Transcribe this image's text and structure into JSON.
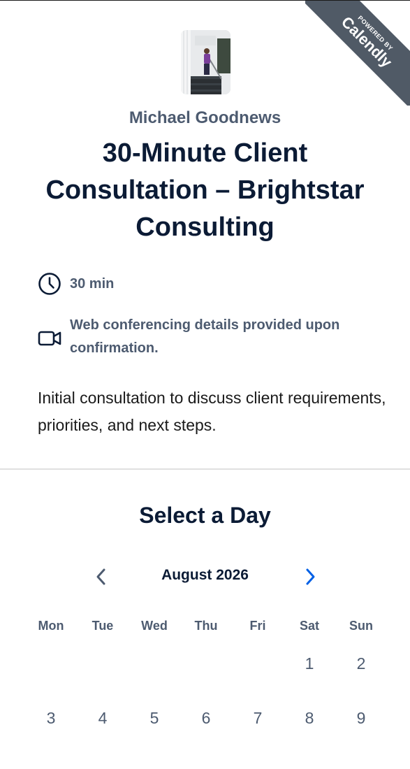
{
  "ribbon": {
    "powered_by": "POWERED BY",
    "brand": "Calendly"
  },
  "host": {
    "name": "Michael Goodnews"
  },
  "event": {
    "title": "30-Minute Client Consultation – Brightstar Consulting",
    "duration": "30 min",
    "conferencing": "Web conferencing details provided upon confirmation.",
    "description": "Initial consultation to discuss client requirements, priorities, and next steps."
  },
  "scheduler": {
    "title": "Select a Day",
    "month": "August 2026",
    "weekdays": [
      "Mon",
      "Tue",
      "Wed",
      "Thu",
      "Fri",
      "Sat",
      "Sun"
    ],
    "week1": [
      "",
      "",
      "",
      "",
      "",
      "1",
      "2"
    ],
    "week2": [
      "3",
      "4",
      "5",
      "6",
      "7",
      "8",
      "9"
    ]
  },
  "icons": {
    "duration": "clock-icon",
    "conferencing": "video-camera-icon",
    "prev": "chevron-left-icon",
    "next": "chevron-right-icon"
  },
  "colors": {
    "accent": "#0060e6",
    "title": "#0b1b35",
    "muted": "#4d5b70",
    "ribbon": "#505a66"
  }
}
